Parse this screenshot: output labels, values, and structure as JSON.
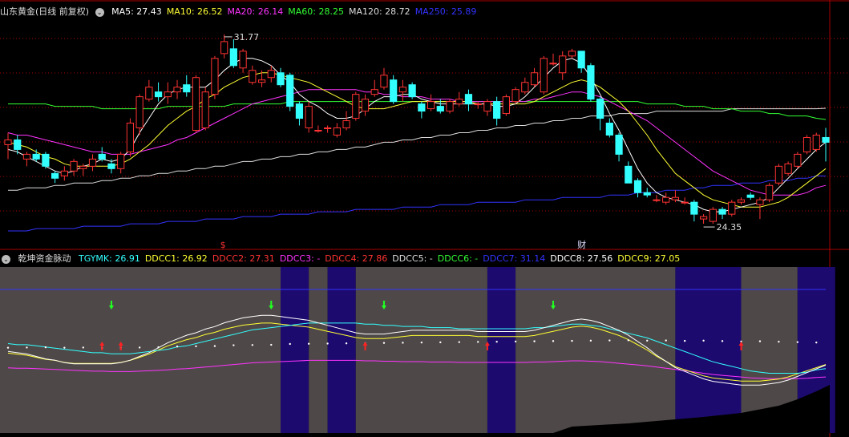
{
  "main": {
    "title": "山东黄金(日线 前复权)",
    "ma": [
      {
        "label": "MA5: 27.43",
        "color": "#ffffff"
      },
      {
        "label": "MA10: 26.52",
        "color": "#ffff33"
      },
      {
        "label": "MA20: 26.14",
        "color": "#ff33ff"
      },
      {
        "label": "MA60: 28.25",
        "color": "#33ff33"
      },
      {
        "label": "MA120: 28.72",
        "color": "#dddddd"
      },
      {
        "label": "MA250: 25.89",
        "color": "#3333ff"
      }
    ],
    "high_marker": "31.77",
    "low_marker": "24.35",
    "event_markers": [
      "$",
      "财"
    ]
  },
  "sub": {
    "title": "乾坤资金脉动",
    "indicators": [
      {
        "label": "TGYMK: 26.91",
        "color": "#33ffff"
      },
      {
        "label": "DDCC1: 26.92",
        "color": "#ffff33"
      },
      {
        "label": "DDCC2: 27.31",
        "color": "#ff3333"
      },
      {
        "label": "DDCC3: -",
        "color": "#ff33ff"
      },
      {
        "label": "DDCC4: 27.86",
        "color": "#ff3333"
      },
      {
        "label": "DDCC5: -",
        "color": "#dddddd"
      },
      {
        "label": "DDCC6: -",
        "color": "#33ff33"
      },
      {
        "label": "DDCC7: 31.14",
        "color": "#3333ff"
      },
      {
        "label": "DDCC8: 27.56",
        "color": "#ffffff"
      },
      {
        "label": "DDCC9: 27.05",
        "color": "#ffff33"
      }
    ]
  },
  "colors": {
    "up": "#ff3333",
    "down": "#33ffff",
    "grid": "#aa0000",
    "band_gray": "#4f4848",
    "band_blue": "#1c0a6e"
  },
  "chart_data": {
    "type": "candlestick",
    "candles": [
      [
        27.2,
        27.7,
        26.6,
        27.4
      ],
      [
        27.4,
        27.6,
        26.8,
        27.0
      ],
      [
        26.6,
        26.9,
        26.3,
        26.8
      ],
      [
        26.8,
        27.0,
        26.5,
        26.6
      ],
      [
        26.8,
        26.9,
        26.2,
        26.3
      ],
      [
        26.0,
        26.1,
        25.6,
        25.8
      ],
      [
        25.9,
        26.3,
        25.7,
        26.1
      ],
      [
        26.1,
        26.6,
        25.9,
        26.5
      ],
      [
        26.2,
        26.4,
        25.9,
        26.3
      ],
      [
        26.3,
        26.8,
        26.1,
        26.6
      ],
      [
        26.8,
        27.1,
        26.5,
        26.6
      ],
      [
        26.4,
        26.6,
        26.0,
        26.2
      ],
      [
        26.2,
        26.9,
        26.0,
        26.8
      ],
      [
        26.9,
        28.3,
        26.7,
        28.1
      ],
      [
        27.9,
        29.3,
        27.6,
        29.2
      ],
      [
        29.1,
        29.9,
        29.0,
        29.6
      ],
      [
        29.4,
        29.8,
        29.0,
        29.2
      ],
      [
        29.2,
        29.8,
        28.9,
        29.4
      ],
      [
        29.4,
        29.9,
        29.1,
        29.6
      ],
      [
        29.7,
        30.1,
        29.2,
        29.4
      ],
      [
        27.8,
        30.1,
        27.7,
        30.0
      ],
      [
        27.9,
        29.6,
        27.8,
        29.4
      ],
      [
        29.3,
        30.9,
        29.1,
        30.8
      ],
      [
        31.0,
        31.8,
        30.8,
        31.5
      ],
      [
        31.2,
        31.6,
        30.4,
        30.5
      ],
      [
        30.4,
        31.2,
        30.2,
        31.1
      ],
      [
        29.8,
        30.5,
        29.7,
        30.3
      ],
      [
        29.8,
        30.3,
        29.6,
        29.9
      ],
      [
        30.0,
        30.5,
        29.8,
        30.3
      ],
      [
        30.2,
        30.4,
        29.6,
        29.7
      ],
      [
        30.1,
        30.2,
        28.6,
        28.8
      ],
      [
        28.9,
        29.0,
        28.0,
        28.3
      ],
      [
        27.9,
        29.0,
        27.7,
        28.8
      ],
      [
        27.8,
        28.0,
        27.7,
        27.8
      ],
      [
        27.9,
        28.0,
        27.7,
        27.9
      ],
      [
        27.6,
        28.1,
        27.5,
        27.9
      ],
      [
        27.9,
        28.6,
        27.8,
        28.2
      ],
      [
        28.3,
        29.4,
        28.2,
        29.3
      ],
      [
        28.6,
        29.3,
        28.4,
        29.1
      ],
      [
        29.3,
        29.9,
        29.2,
        29.5
      ],
      [
        29.6,
        30.4,
        29.5,
        30.1
      ],
      [
        29.9,
        30.1,
        28.9,
        29.0
      ],
      [
        29.4,
        29.9,
        29.0,
        29.6
      ],
      [
        29.7,
        29.8,
        29.1,
        29.2
      ],
      [
        28.9,
        29.0,
        28.3,
        28.6
      ],
      [
        28.7,
        29.3,
        28.6,
        29.0
      ],
      [
        28.8,
        29.1,
        28.5,
        28.6
      ],
      [
        28.6,
        29.1,
        28.5,
        29.0
      ],
      [
        28.9,
        29.4,
        28.8,
        29.1
      ],
      [
        29.3,
        29.5,
        28.6,
        28.9
      ],
      [
        28.9,
        29.0,
        28.7,
        28.9
      ],
      [
        28.6,
        29.1,
        28.4,
        29.0
      ],
      [
        29.0,
        29.2,
        28.0,
        28.3
      ],
      [
        28.5,
        29.3,
        28.4,
        29.2
      ],
      [
        29.0,
        29.6,
        28.9,
        29.5
      ],
      [
        29.4,
        30.0,
        29.3,
        29.8
      ],
      [
        29.7,
        30.4,
        29.6,
        30.2
      ],
      [
        29.4,
        30.9,
        29.3,
        30.8
      ],
      [
        30.6,
        31.0,
        30.5,
        30.6
      ],
      [
        30.2,
        31.1,
        29.9,
        30.9
      ],
      [
        30.9,
        31.2,
        30.8,
        31.1
      ],
      [
        31.1,
        30.3,
        30.2,
        30.4
      ],
      [
        30.5,
        30.6,
        29.0,
        29.1
      ],
      [
        29.1,
        29.2,
        27.8,
        28.3
      ],
      [
        28.1,
        28.3,
        27.5,
        27.6
      ],
      [
        27.6,
        27.7,
        26.5,
        26.8
      ],
      [
        26.3,
        26.5,
        25.6,
        25.6
      ],
      [
        25.7,
        25.8,
        25.0,
        25.2
      ],
      [
        25.2,
        25.4,
        25.0,
        25.1
      ],
      [
        24.9,
        25.1,
        24.8,
        24.9
      ],
      [
        24.8,
        25.2,
        24.7,
        25.0
      ],
      [
        24.9,
        25.3,
        24.8,
        25.0
      ],
      [
        24.8,
        25.0,
        24.7,
        24.8
      ],
      [
        24.8,
        24.9,
        24.0,
        24.3
      ],
      [
        24.1,
        24.3,
        23.9,
        24.2
      ],
      [
        24.0,
        24.6,
        23.9,
        24.5
      ],
      [
        24.5,
        24.6,
        24.1,
        24.3
      ],
      [
        24.3,
        24.9,
        24.2,
        24.8
      ],
      [
        24.8,
        25.0,
        24.7,
        24.9
      ],
      [
        25.1,
        25.2,
        24.9,
        25.0
      ],
      [
        24.7,
        25.0,
        24.1,
        24.9
      ],
      [
        24.9,
        25.6,
        24.8,
        25.5
      ],
      [
        25.6,
        26.4,
        25.5,
        26.3
      ],
      [
        26.0,
        26.5,
        25.9,
        26.4
      ],
      [
        26.3,
        26.9,
        26.2,
        26.8
      ],
      [
        26.9,
        27.6,
        26.8,
        27.5
      ],
      [
        27.0,
        27.7,
        26.9,
        27.6
      ],
      [
        27.5,
        27.9,
        26.5,
        27.3
      ]
    ],
    "ma5": [
      27.0,
      26.9,
      26.7,
      26.5,
      26.3,
      26.1,
      26.0,
      26.1,
      26.3,
      26.4,
      26.6,
      26.5,
      26.6,
      27.0,
      27.7,
      28.3,
      28.9,
      29.3,
      29.5,
      29.6,
      29.6,
      29.6,
      29.9,
      30.3,
      30.6,
      30.8,
      30.8,
      30.7,
      30.5,
      30.1,
      29.8,
      29.3,
      29.0,
      28.8,
      28.5,
      28.3,
      28.3,
      28.4,
      28.7,
      29.0,
      29.2,
      29.2,
      29.3,
      29.3,
      29.1,
      29.0,
      28.9,
      28.9,
      28.9,
      28.9,
      28.9,
      28.9,
      28.8,
      28.8,
      28.9,
      29.2,
      29.6,
      30.0,
      30.4,
      30.7,
      30.8,
      30.6,
      30.0,
      29.3,
      28.5,
      27.8,
      27.0,
      26.2,
      25.6,
      25.2,
      25.0,
      24.9,
      24.8,
      24.7,
      24.5,
      24.4,
      24.4,
      24.5,
      24.6,
      24.7,
      24.8,
      25.0,
      25.4,
      25.8,
      26.2,
      26.6,
      27.0,
      27.3
    ],
    "ma10": [
      27.3,
      27.2,
      27.1,
      26.9,
      26.7,
      26.6,
      26.4,
      26.3,
      26.3,
      26.3,
      26.3,
      26.3,
      26.4,
      26.6,
      26.9,
      27.2,
      27.6,
      28.0,
      28.3,
      28.6,
      28.8,
      29.1,
      29.3,
      29.6,
      29.8,
      30.0,
      30.1,
      30.2,
      30.2,
      30.1,
      30.0,
      29.9,
      29.8,
      29.6,
      29.4,
      29.2,
      29.0,
      28.8,
      28.7,
      28.7,
      28.7,
      28.8,
      28.9,
      29.0,
      29.0,
      29.0,
      29.0,
      29.0,
      29.0,
      29.0,
      28.9,
      28.9,
      28.9,
      28.9,
      28.9,
      28.9,
      29.0,
      29.2,
      29.4,
      29.6,
      29.8,
      29.9,
      29.8,
      29.6,
      29.3,
      29.0,
      28.6,
      28.1,
      27.6,
      27.0,
      26.5,
      26.0,
      25.7,
      25.4,
      25.1,
      24.9,
      24.8,
      24.7,
      24.6,
      24.6,
      24.6,
      24.7,
      24.8,
      25.0,
      25.3,
      25.6,
      25.9,
      26.2
    ],
    "ma20": [
      27.7,
      27.6,
      27.6,
      27.5,
      27.4,
      27.3,
      27.2,
      27.1,
      27.0,
      26.9,
      26.9,
      26.8,
      26.8,
      26.8,
      26.9,
      27.0,
      27.1,
      27.2,
      27.4,
      27.5,
      27.7,
      27.9,
      28.1,
      28.3,
      28.5,
      28.7,
      28.9,
      29.0,
      29.1,
      29.2,
      29.3,
      29.4,
      29.5,
      29.5,
      29.5,
      29.5,
      29.5,
      29.5,
      29.4,
      29.4,
      29.3,
      29.3,
      29.2,
      29.2,
      29.2,
      29.1,
      29.1,
      29.1,
      29.0,
      29.0,
      29.0,
      29.0,
      29.0,
      29.0,
      29.0,
      29.0,
      29.1,
      29.1,
      29.2,
      29.3,
      29.4,
      29.4,
      29.3,
      29.2,
      29.0,
      28.8,
      28.6,
      28.4,
      28.2,
      27.9,
      27.6,
      27.3,
      27.0,
      26.7,
      26.4,
      26.1,
      25.9,
      25.7,
      25.5,
      25.3,
      25.2,
      25.1,
      25.1,
      25.1,
      25.1,
      25.2,
      25.4,
      25.5
    ],
    "ma60": [
      28.9,
      28.9,
      28.9,
      28.9,
      28.9,
      28.8,
      28.8,
      28.8,
      28.8,
      28.8,
      28.7,
      28.7,
      28.7,
      28.7,
      28.7,
      28.7,
      28.7,
      28.8,
      28.8,
      28.8,
      28.8,
      28.8,
      28.8,
      28.8,
      28.9,
      28.9,
      28.9,
      28.9,
      28.9,
      28.9,
      29.0,
      29.0,
      29.0,
      29.0,
      29.0,
      29.0,
      29.0,
      29.0,
      29.0,
      29.0,
      29.0,
      29.0,
      29.0,
      29.0,
      29.0,
      29.0,
      29.0,
      29.0,
      29.0,
      29.0,
      29.0,
      29.0,
      29.0,
      29.0,
      29.0,
      29.0,
      29.0,
      29.0,
      29.0,
      29.0,
      29.0,
      29.0,
      29.0,
      29.0,
      29.0,
      29.0,
      29.0,
      29.0,
      28.9,
      28.9,
      28.9,
      28.9,
      28.8,
      28.8,
      28.8,
      28.7,
      28.7,
      28.7,
      28.6,
      28.6,
      28.6,
      28.5,
      28.5,
      28.4,
      28.4,
      28.4,
      28.3,
      28.25
    ],
    "ma120": [
      25.3,
      25.3,
      25.4,
      25.4,
      25.4,
      25.5,
      25.5,
      25.6,
      25.6,
      25.6,
      25.7,
      25.7,
      25.8,
      25.8,
      25.9,
      25.9,
      26.0,
      26.0,
      26.1,
      26.1,
      26.2,
      26.2,
      26.3,
      26.3,
      26.4,
      26.5,
      26.5,
      26.6,
      26.6,
      26.7,
      26.7,
      26.8,
      26.8,
      26.9,
      26.9,
      27.0,
      27.0,
      27.1,
      27.1,
      27.2,
      27.3,
      27.3,
      27.4,
      27.4,
      27.5,
      27.5,
      27.6,
      27.6,
      27.7,
      27.7,
      27.8,
      27.8,
      27.9,
      27.9,
      28.0,
      28.0,
      28.1,
      28.1,
      28.2,
      28.2,
      28.3,
      28.3,
      28.4,
      28.4,
      28.4,
      28.5,
      28.5,
      28.5,
      28.5,
      28.6,
      28.6,
      28.6,
      28.6,
      28.6,
      28.6,
      28.6,
      28.6,
      28.7,
      28.7,
      28.7,
      28.7,
      28.7,
      28.7,
      28.7,
      28.7,
      28.7,
      28.7,
      28.72
    ],
    "ma250": [
      23.6,
      23.6,
      23.6,
      23.7,
      23.7,
      23.7,
      23.7,
      23.7,
      23.8,
      23.8,
      23.8,
      23.8,
      23.8,
      23.9,
      23.9,
      23.9,
      23.9,
      24.0,
      24.0,
      24.0,
      24.0,
      24.1,
      24.1,
      24.1,
      24.1,
      24.2,
      24.2,
      24.2,
      24.2,
      24.3,
      24.3,
      24.3,
      24.3,
      24.4,
      24.4,
      24.4,
      24.4,
      24.5,
      24.5,
      24.5,
      24.5,
      24.5,
      24.6,
      24.6,
      24.6,
      24.6,
      24.7,
      24.7,
      24.7,
      24.7,
      24.8,
      24.8,
      24.8,
      24.8,
      24.8,
      24.9,
      24.9,
      24.9,
      24.9,
      25.0,
      25.0,
      25.0,
      25.0,
      25.0,
      25.1,
      25.1,
      25.1,
      25.2,
      25.2,
      25.2,
      25.3,
      25.3,
      25.3,
      25.4,
      25.4,
      25.5,
      25.5,
      25.5,
      25.6,
      25.6,
      25.6,
      25.7,
      25.7,
      25.7,
      25.8,
      25.8,
      25.9,
      25.89
    ],
    "ylim": [
      23.2,
      32.5
    ],
    "sub_bands": [
      {
        "from": 0,
        "to": 29,
        "color": "gray"
      },
      {
        "from": 29,
        "to": 32,
        "color": "blue"
      },
      {
        "from": 32,
        "to": 34,
        "color": "gray"
      },
      {
        "from": 34,
        "to": 84,
        "color": "blue"
      }
    ],
    "sub_ylim": [
      20,
      36
    ]
  }
}
